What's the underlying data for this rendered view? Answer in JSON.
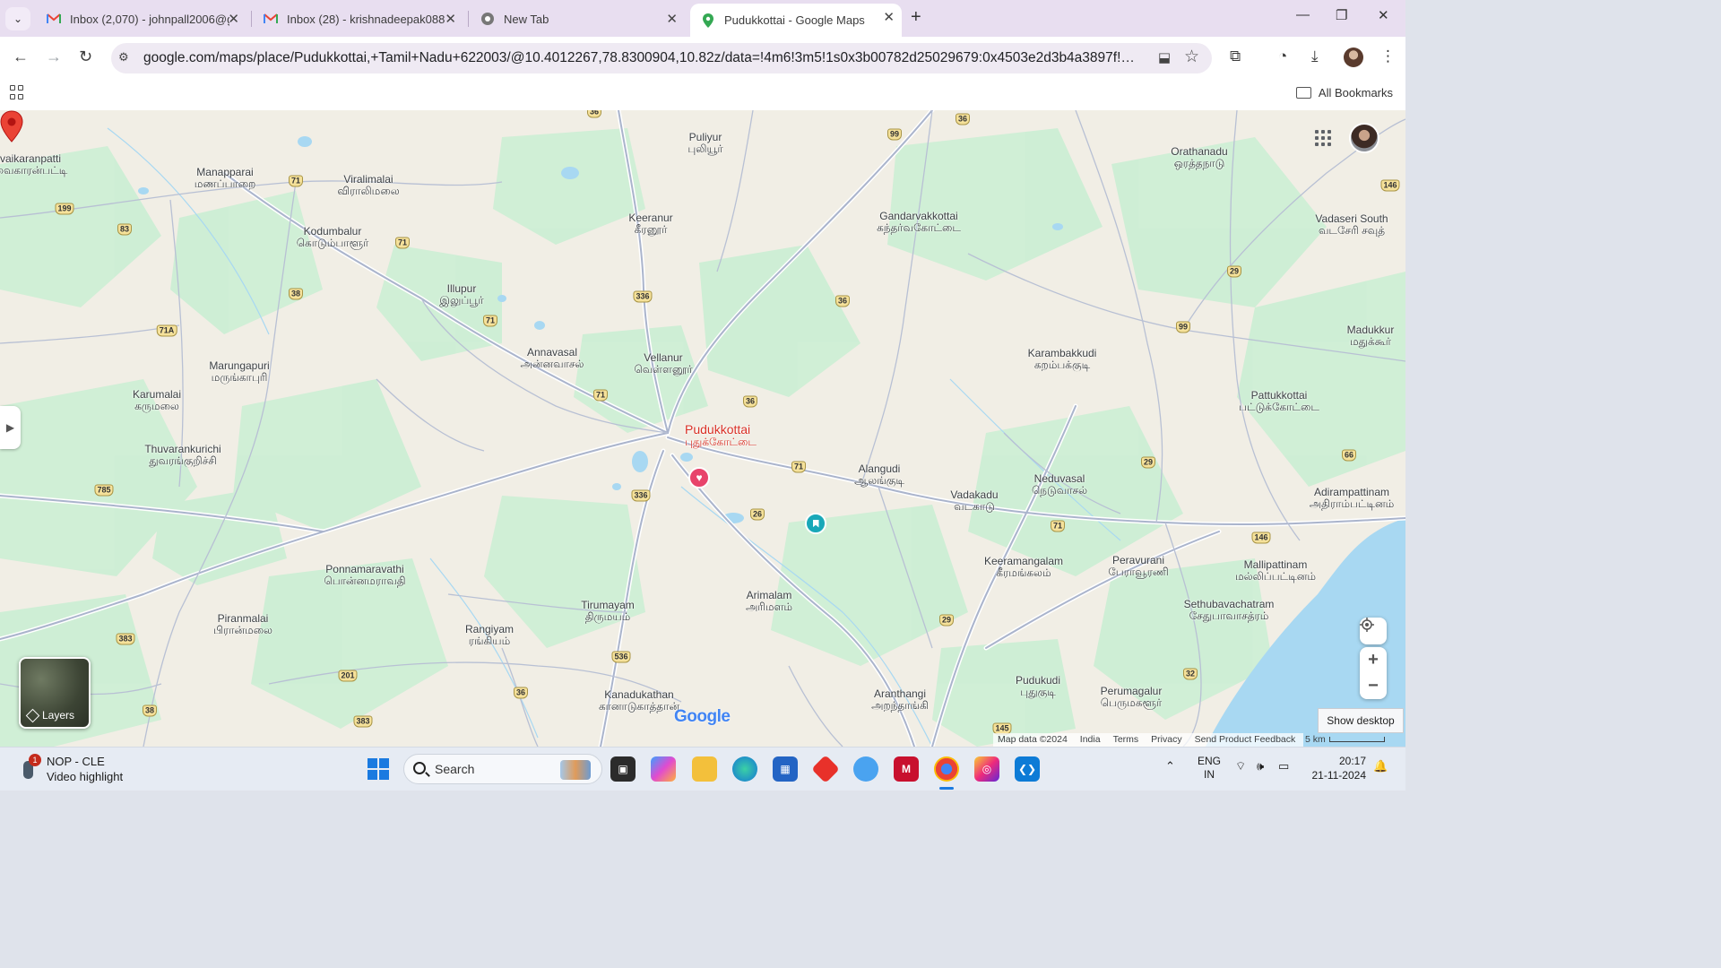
{
  "browser": {
    "tabs": [
      {
        "title": "Inbox (2,070) - johnpall2006@g",
        "favicon": "gmail-icon",
        "active": false
      },
      {
        "title": "Inbox (28) - krishnadeepak088",
        "favicon": "gmail-icon",
        "active": false
      },
      {
        "title": "New Tab",
        "favicon": "chrome-icon",
        "active": false
      },
      {
        "title": "Pudukkottai - Google Maps",
        "favicon": "maps-icon",
        "active": true
      }
    ],
    "url": "google.com/maps/place/Pudukkottai,+Tamil+Nadu+622003/@10.4012267,78.8300904,10.82z/data=!4m6!3m5!1s0x3b00782d25029679:0x4503e2d3b4a3897f!8m2!3d10.38328...",
    "all_bookmarks": "All Bookmarks"
  },
  "map": {
    "selected_place": {
      "name": "Pudukkottai",
      "name_ta": "புதுக்கோட்டை"
    },
    "places": [
      {
        "en": "Puliyur",
        "ta": "புலியூர்"
      },
      {
        "en": "Orathanadu",
        "ta": "ஒரத்தநாடு"
      },
      {
        "en": "Manapparai",
        "ta": "மணப்பாறை"
      },
      {
        "en": "Viralimalai",
        "ta": "விராலிமலை"
      },
      {
        "en": "Keeranur",
        "ta": "கீரனூர்"
      },
      {
        "en": "Gandarvakkottai",
        "ta": "கந்தர்வகோட்டை"
      },
      {
        "en": "Vadaseri South",
        "ta": "வடசேரி சவுத்"
      },
      {
        "en": "Kodumbalur",
        "ta": "கொடும்பாளூர்"
      },
      {
        "en": "Illupur",
        "ta": "இலுப்பூர்"
      },
      {
        "en": "Annavasal",
        "ta": "அன்னவாசல்"
      },
      {
        "en": "Vellanur",
        "ta": "வெள்ளனூர்"
      },
      {
        "en": "Karambakkudi",
        "ta": "கறம்பக்குடி"
      },
      {
        "en": "Madukkur",
        "ta": "மதுக்கூர்"
      },
      {
        "en": "Marungapuri",
        "ta": "மருங்காபுரி"
      },
      {
        "en": "Karumalai",
        "ta": "கருமலை"
      },
      {
        "en": "Pattukkottai",
        "ta": "பட்டுக்கோட்டை"
      },
      {
        "en": "Thuvarankurichi",
        "ta": "துவரங்குறிச்சி"
      },
      {
        "en": "Alangudi",
        "ta": "ஆலங்குடி"
      },
      {
        "en": "Neduvasal",
        "ta": "நெடுவாசல்"
      },
      {
        "en": "Vadakadu",
        "ta": "வடகாடு"
      },
      {
        "en": "Adirampattinam",
        "ta": "அதிராம்பட்டினம்"
      },
      {
        "en": "Keeramangalam",
        "ta": "கீரமங்கலம்"
      },
      {
        "en": "Peravurani",
        "ta": "பேராவூரணி"
      },
      {
        "en": "Mallipattinam",
        "ta": "மல்லிப்பட்டினம்"
      },
      {
        "en": "Ponnamaravathi",
        "ta": "பொன்னமராவதி"
      },
      {
        "en": "Arimalam",
        "ta": "அரிமளம்"
      },
      {
        "en": "Tirumayam",
        "ta": "திருமயம்"
      },
      {
        "en": "Sethubavachatram",
        "ta": "சேதுபாவாசத்ரம்"
      },
      {
        "en": "Piranmalai",
        "ta": "பிரான்மலை"
      },
      {
        "en": "Rangiyam",
        "ta": "ரங்கியம்"
      },
      {
        "en": "Kanadukathan",
        "ta": "கானாடுகாத்தான்"
      },
      {
        "en": "Aranthangi",
        "ta": "அறந்தாங்கி"
      },
      {
        "en": "Pudukudi",
        "ta": "புதுகுடி"
      },
      {
        "en": "Perumagalur",
        "ta": "பெருமகளூர்"
      },
      {
        "en": "vaikaranpatti",
        "ta": "வைகாரன்பட்டி"
      }
    ],
    "road_shields": [
      "36",
      "99",
      "36",
      "71",
      "199",
      "83",
      "71",
      "38",
      "336",
      "71",
      "36",
      "71A",
      "36",
      "71",
      "146",
      "29",
      "99",
      "66",
      "29",
      "785",
      "336",
      "26",
      "71",
      "146",
      "71",
      "29",
      "383",
      "201",
      "536",
      "36",
      "38",
      "383",
      "32",
      "145"
    ],
    "layers_label": "Layers",
    "show_desktop": "Show desktop",
    "google_logo": "Google",
    "attribution": [
      "Map data ©2024",
      "India",
      "Terms",
      "Privacy",
      "Send Product Feedback"
    ],
    "scale": "5 km"
  },
  "taskbar": {
    "widget_badge": "1",
    "widget_title": "NOP - CLE",
    "widget_subtitle": "Video highlight",
    "search_placeholder": "Search",
    "lang_top": "ENG",
    "lang_bottom": "IN",
    "time": "20:17",
    "date": "21-11-2024"
  },
  "colors": {
    "map_land": "#f1eee5",
    "map_green": "#cdeed5",
    "map_water": "#a8d8f2",
    "road": "#aab4cc",
    "pin_red": "#d93025",
    "tabstrip": "#e8def0"
  }
}
